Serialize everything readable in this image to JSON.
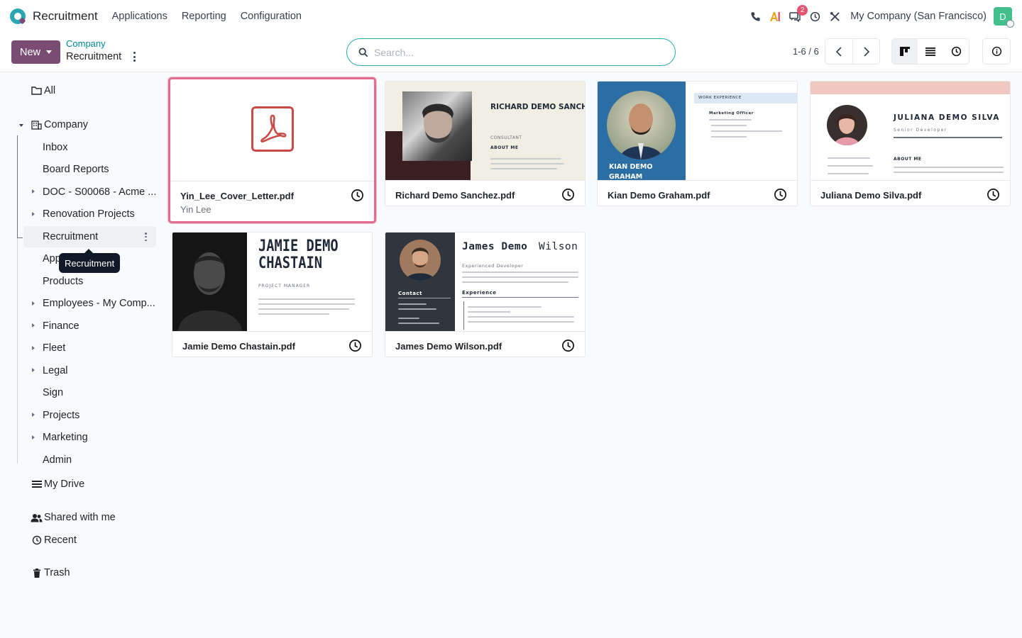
{
  "app": {
    "name": "Recruitment",
    "menus": [
      "Applications",
      "Reporting",
      "Configuration"
    ],
    "company": "My Company (San Francisco)",
    "avatar_letter": "D",
    "messages_badge": "2"
  },
  "control": {
    "new_label": "New",
    "breadcrumb_parent": "Company",
    "breadcrumb_current": "Recruitment",
    "search_placeholder": "Search...",
    "pager": "1-6 / 6"
  },
  "sidebar": {
    "all": "All",
    "company": "Company",
    "children": [
      "Inbox",
      "Board Reports",
      "DOC - S00068 - Acme ...",
      "Renovation Projects",
      "Recruitment",
      "App",
      "Products",
      "Employees - My Comp...",
      "Finance",
      "Fleet",
      "Legal",
      "Sign",
      "Projects",
      "Marketing",
      "Admin"
    ],
    "my_drive": "My Drive",
    "shared": "Shared with me",
    "recent": "Recent",
    "trash": "Trash",
    "tooltip": "Recruitment"
  },
  "documents": [
    {
      "name": "Yin_Lee_Cover_Letter.pdf",
      "owner": "Yin Lee"
    },
    {
      "name": "Richard Demo Sanchez.pdf",
      "thumb_title": "RICHARD DEMO SANCHEZ",
      "thumb_sub": "CONSULTANT",
      "thumb_section": "ABOUT ME"
    },
    {
      "name": "Kian Demo Graham.pdf",
      "thumb_title": "KIAN DEMO GRAHAM",
      "thumb_section": "WORK EXPERIENCE",
      "thumb_role": "Marketing Officer"
    },
    {
      "name": "Juliana Demo Silva.pdf",
      "thumb_title": "JULIANA DEMO SILVA",
      "thumb_sub": "Senior Developer",
      "thumb_section": "ABOUT ME"
    },
    {
      "name": "Jamie Demo Chastain.pdf",
      "thumb_title1": "JAMIE DEMO",
      "thumb_title2": "CHASTAIN",
      "thumb_sub": "PROJECT MANAGER"
    },
    {
      "name": "James Demo Wilson.pdf",
      "thumb_title": "James Demo",
      "thumb_title_b": "Wilson",
      "thumb_sub": "Experienced Developer",
      "thumb_contact": "Contact",
      "thumb_exp": "Experience"
    }
  ],
  "colors": {
    "brand": "#7b4c73",
    "teal": "#018b96",
    "selected_border": "#e26b8f",
    "pdf_red": "#c94a47"
  }
}
